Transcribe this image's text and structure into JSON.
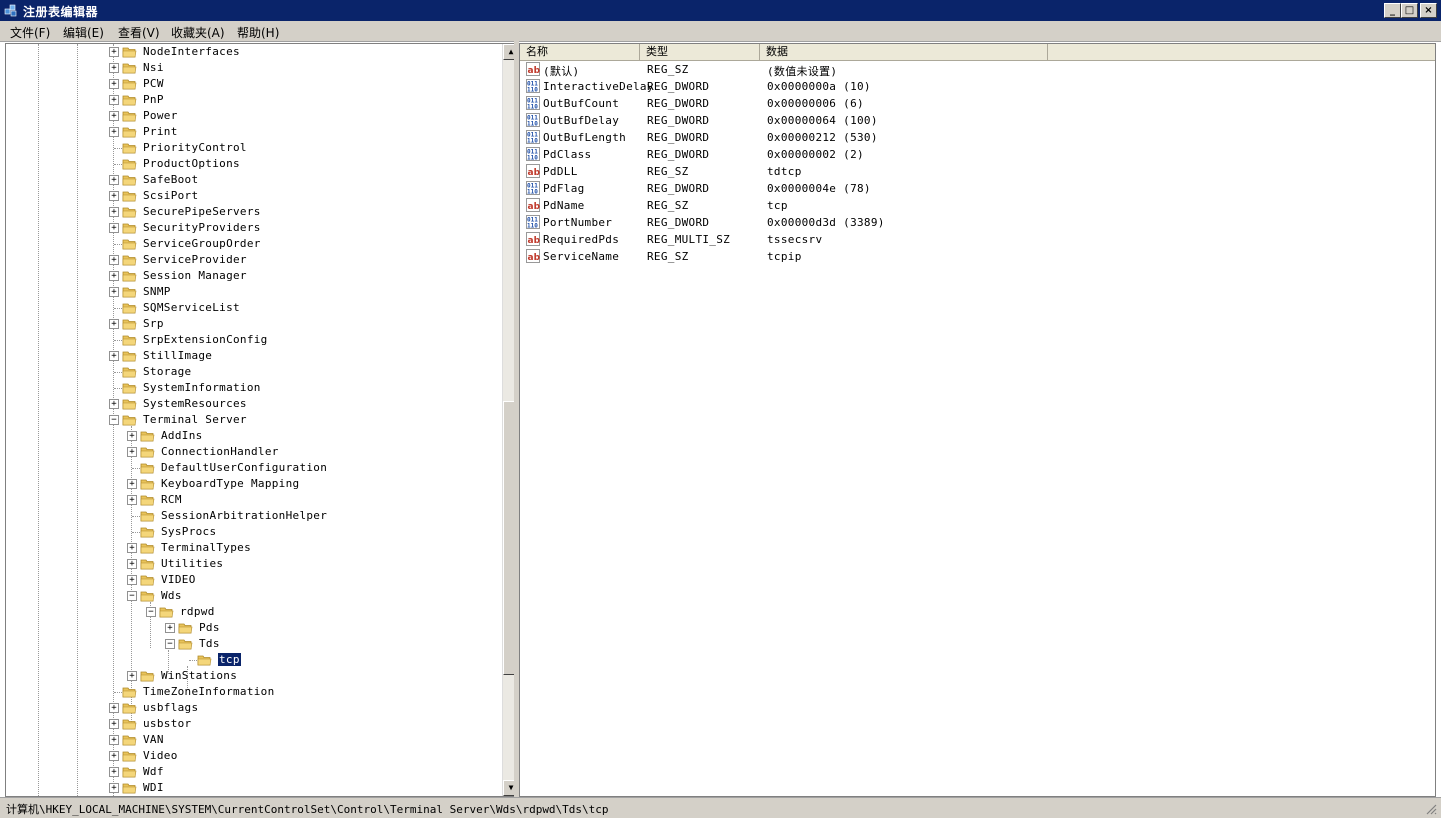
{
  "window": {
    "title": "注册表编辑器",
    "buttons": {
      "minimize": "_",
      "maximize": "□",
      "close": "×"
    }
  },
  "menu": [
    "文件(F)",
    "编辑(E)",
    "查看(V)",
    "收藏夹(A)",
    "帮助(H)"
  ],
  "tree": {
    "nodes": [
      {
        "label": "NodeInterfaces",
        "level": 0,
        "expander": "plus"
      },
      {
        "label": "Nsi",
        "level": 0,
        "expander": "plus"
      },
      {
        "label": "PCW",
        "level": 0,
        "expander": "plus"
      },
      {
        "label": "PnP",
        "level": 0,
        "expander": "plus"
      },
      {
        "label": "Power",
        "level": 0,
        "expander": "plus"
      },
      {
        "label": "Print",
        "level": 0,
        "expander": "plus"
      },
      {
        "label": "PriorityControl",
        "level": 0,
        "expander": "none"
      },
      {
        "label": "ProductOptions",
        "level": 0,
        "expander": "none"
      },
      {
        "label": "SafeBoot",
        "level": 0,
        "expander": "plus"
      },
      {
        "label": "ScsiPort",
        "level": 0,
        "expander": "plus"
      },
      {
        "label": "SecurePipeServers",
        "level": 0,
        "expander": "plus"
      },
      {
        "label": "SecurityProviders",
        "level": 0,
        "expander": "plus"
      },
      {
        "label": "ServiceGroupOrder",
        "level": 0,
        "expander": "none"
      },
      {
        "label": "ServiceProvider",
        "level": 0,
        "expander": "plus"
      },
      {
        "label": "Session Manager",
        "level": 0,
        "expander": "plus"
      },
      {
        "label": "SNMP",
        "level": 0,
        "expander": "plus"
      },
      {
        "label": "SQMServiceList",
        "level": 0,
        "expander": "none"
      },
      {
        "label": "Srp",
        "level": 0,
        "expander": "plus"
      },
      {
        "label": "SrpExtensionConfig",
        "level": 0,
        "expander": "none"
      },
      {
        "label": "StillImage",
        "level": 0,
        "expander": "plus"
      },
      {
        "label": "Storage",
        "level": 0,
        "expander": "none"
      },
      {
        "label": "SystemInformation",
        "level": 0,
        "expander": "none"
      },
      {
        "label": "SystemResources",
        "level": 0,
        "expander": "plus"
      },
      {
        "label": "Terminal Server",
        "level": 0,
        "expander": "minus"
      },
      {
        "label": "AddIns",
        "level": 1,
        "expander": "plus"
      },
      {
        "label": "ConnectionHandler",
        "level": 1,
        "expander": "plus"
      },
      {
        "label": "DefaultUserConfiguration",
        "level": 1,
        "expander": "none"
      },
      {
        "label": "KeyboardType Mapping",
        "level": 1,
        "expander": "plus"
      },
      {
        "label": "RCM",
        "level": 1,
        "expander": "plus"
      },
      {
        "label": "SessionArbitrationHelper",
        "level": 1,
        "expander": "none"
      },
      {
        "label": "SysProcs",
        "level": 1,
        "expander": "none"
      },
      {
        "label": "TerminalTypes",
        "level": 1,
        "expander": "plus"
      },
      {
        "label": "Utilities",
        "level": 1,
        "expander": "plus"
      },
      {
        "label": "VIDEO",
        "level": 1,
        "expander": "plus"
      },
      {
        "label": "Wds",
        "level": 1,
        "expander": "minus"
      },
      {
        "label": "rdpwd",
        "level": 2,
        "expander": "minus"
      },
      {
        "label": "Pds",
        "level": 3,
        "expander": "plus"
      },
      {
        "label": "Tds",
        "level": 3,
        "expander": "minus"
      },
      {
        "label": "tcp",
        "level": 4,
        "expander": "none",
        "selected": true
      },
      {
        "label": "WinStations",
        "level": 1,
        "expander": "plus"
      },
      {
        "label": "TimeZoneInformation",
        "level": 0,
        "expander": "none"
      },
      {
        "label": "usbflags",
        "level": 0,
        "expander": "plus"
      },
      {
        "label": "usbstor",
        "level": 0,
        "expander": "plus"
      },
      {
        "label": "VAN",
        "level": 0,
        "expander": "plus"
      },
      {
        "label": "Video",
        "level": 0,
        "expander": "plus"
      },
      {
        "label": "Wdf",
        "level": 0,
        "expander": "plus"
      },
      {
        "label": "WDI",
        "level": 0,
        "expander": "plus"
      }
    ]
  },
  "list": {
    "headers": {
      "name": "名称",
      "type": "类型",
      "data": "数据"
    },
    "rows": [
      {
        "icon": "ab",
        "name": "(默认)",
        "type": "REG_SZ",
        "data": "(数值未设置)"
      },
      {
        "icon": "bin",
        "name": "InteractiveDelay",
        "type": "REG_DWORD",
        "data": "0x0000000a (10)"
      },
      {
        "icon": "bin",
        "name": "OutBufCount",
        "type": "REG_DWORD",
        "data": "0x00000006 (6)"
      },
      {
        "icon": "bin",
        "name": "OutBufDelay",
        "type": "REG_DWORD",
        "data": "0x00000064 (100)"
      },
      {
        "icon": "bin",
        "name": "OutBufLength",
        "type": "REG_DWORD",
        "data": "0x00000212 (530)"
      },
      {
        "icon": "bin",
        "name": "PdClass",
        "type": "REG_DWORD",
        "data": "0x00000002 (2)"
      },
      {
        "icon": "ab",
        "name": "PdDLL",
        "type": "REG_SZ",
        "data": "tdtcp"
      },
      {
        "icon": "bin",
        "name": "PdFlag",
        "type": "REG_DWORD",
        "data": "0x0000004e (78)"
      },
      {
        "icon": "ab",
        "name": "PdName",
        "type": "REG_SZ",
        "data": "tcp"
      },
      {
        "icon": "bin",
        "name": "PortNumber",
        "type": "REG_DWORD",
        "data": "0x00000d3d (3389)"
      },
      {
        "icon": "ab",
        "name": "RequiredPds",
        "type": "REG_MULTI_SZ",
        "data": "tssecsrv"
      },
      {
        "icon": "ab",
        "name": "ServiceName",
        "type": "REG_SZ",
        "data": "tcpip"
      }
    ]
  },
  "status": "计算机\\HKEY_LOCAL_MACHINE\\SYSTEM\\CurrentControlSet\\Control\\Terminal Server\\Wds\\rdpwd\\Tds\\tcp",
  "colors": {
    "title_bg": "#0a246a",
    "chrome": "#d4d0c8",
    "folder": "#e8c35a",
    "ab_icon": "#c0392b",
    "bin_icon": "#1f4fa8"
  }
}
